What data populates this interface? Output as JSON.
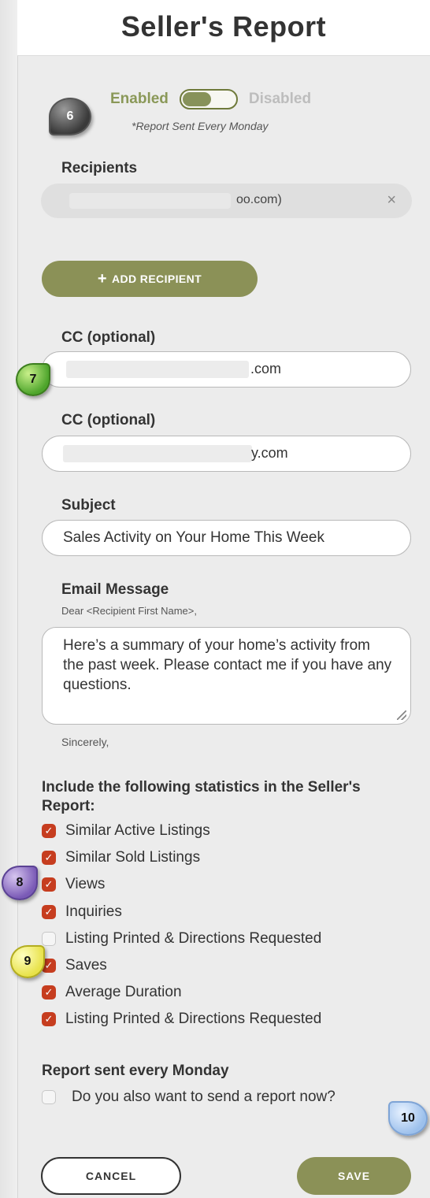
{
  "header": {
    "title": "Seller's Report"
  },
  "toggle": {
    "enabled_label": "Enabled",
    "disabled_label": "Disabled",
    "state": "enabled",
    "note": "*Report Sent Every Monday"
  },
  "recipients": {
    "label": "Recipients",
    "chip_text": "oo.com)",
    "remove_glyph": "×"
  },
  "add_recipient": {
    "plus": "+",
    "label": "ADD RECIPIENT"
  },
  "cc1": {
    "label": "CC (optional)",
    "value_suffix": ".com"
  },
  "cc2": {
    "label": "CC (optional)",
    "value_suffix": "y.com"
  },
  "subject": {
    "label": "Subject",
    "value": "Sales Activity on Your Home This Week"
  },
  "message": {
    "label": "Email Message",
    "greeting": "Dear <Recipient First Name>,",
    "body": "Here’s a summary of your home’s activity from the past week. Please contact me if you have any questions.",
    "closing": "Sincerely,"
  },
  "stats": {
    "heading": "Include the following statistics in the Seller's Report:",
    "items": [
      {
        "label": "Similar Active Listings",
        "checked": true
      },
      {
        "label": "Similar Sold Listings",
        "checked": true
      },
      {
        "label": "Views",
        "checked": true
      },
      {
        "label": "Inquiries",
        "checked": true
      },
      {
        "label": "Listing Printed & Directions Requested",
        "checked": false
      },
      {
        "label": "Saves",
        "checked": true
      },
      {
        "label": "Average Duration",
        "checked": true
      },
      {
        "label": "Listing Printed & Directions Requested",
        "checked": true
      }
    ]
  },
  "report_now": {
    "heading": "Report sent every Monday",
    "label": "Do you also want to send a report now?",
    "checked": false
  },
  "footer": {
    "cancel": "CANCEL",
    "save": "SAVE"
  },
  "callouts": {
    "c6": "6",
    "c7": "7",
    "c8": "8",
    "c9": "9",
    "c10": "10"
  },
  "colors": {
    "accent": "#8b9157",
    "checkbox": "#c63d1f",
    "disabled_text": "#bdbdbd"
  }
}
